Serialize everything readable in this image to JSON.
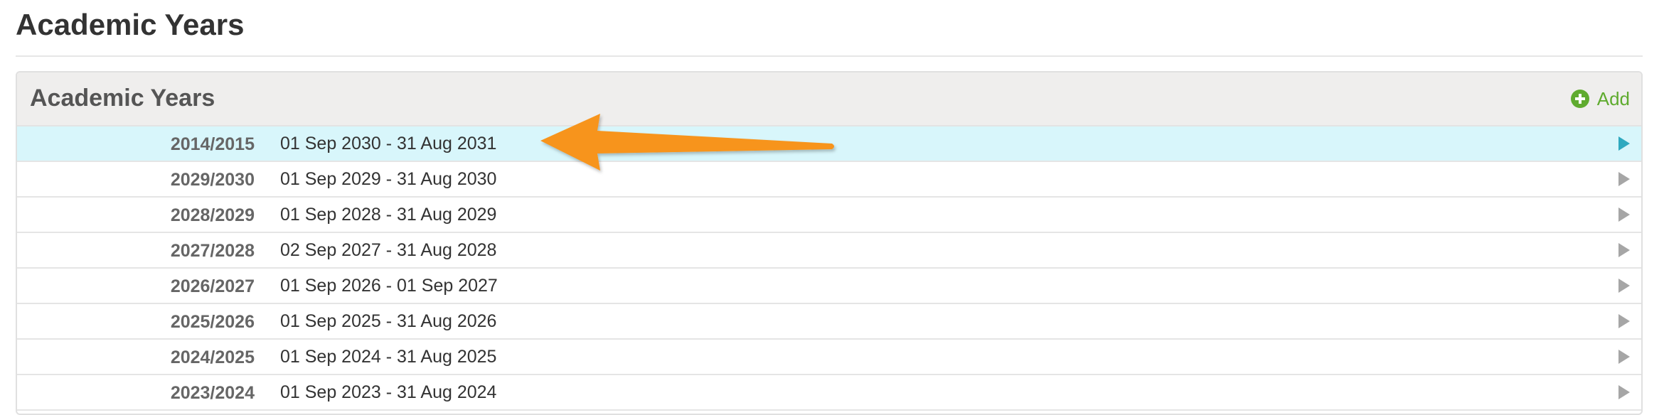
{
  "page": {
    "title": "Academic Years"
  },
  "panel": {
    "title": "Academic Years",
    "add_label": "Add",
    "add_icon": "plus-circle-icon"
  },
  "rows": [
    {
      "year": "2014/2015",
      "dates": "01 Sep 2030 - 31 Aug 2031",
      "active": true
    },
    {
      "year": "2029/2030",
      "dates": "01 Sep 2029 - 31 Aug 2030",
      "active": false
    },
    {
      "year": "2028/2029",
      "dates": "01 Sep 2028 - 31 Aug 2029",
      "active": false
    },
    {
      "year": "2027/2028",
      "dates": "02 Sep 2027 - 31 Aug 2028",
      "active": false
    },
    {
      "year": "2026/2027",
      "dates": "01 Sep 2026 - 01 Sep 2027",
      "active": false
    },
    {
      "year": "2025/2026",
      "dates": "01 Sep 2025 - 31 Aug 2026",
      "active": false
    },
    {
      "year": "2024/2025",
      "dates": "01 Sep 2024 - 31 Aug 2025",
      "active": false
    },
    {
      "year": "2023/2024",
      "dates": "01 Sep 2023 - 31 Aug 2024",
      "active": false
    }
  ],
  "colors": {
    "accent_green": "#5fab2f",
    "active_row_bg": "#d8f6fb",
    "active_arrow": "#2fa9bf",
    "annotation_orange": "#f7941d"
  },
  "annotation": {
    "icon": "orange-pointer-arrow"
  }
}
